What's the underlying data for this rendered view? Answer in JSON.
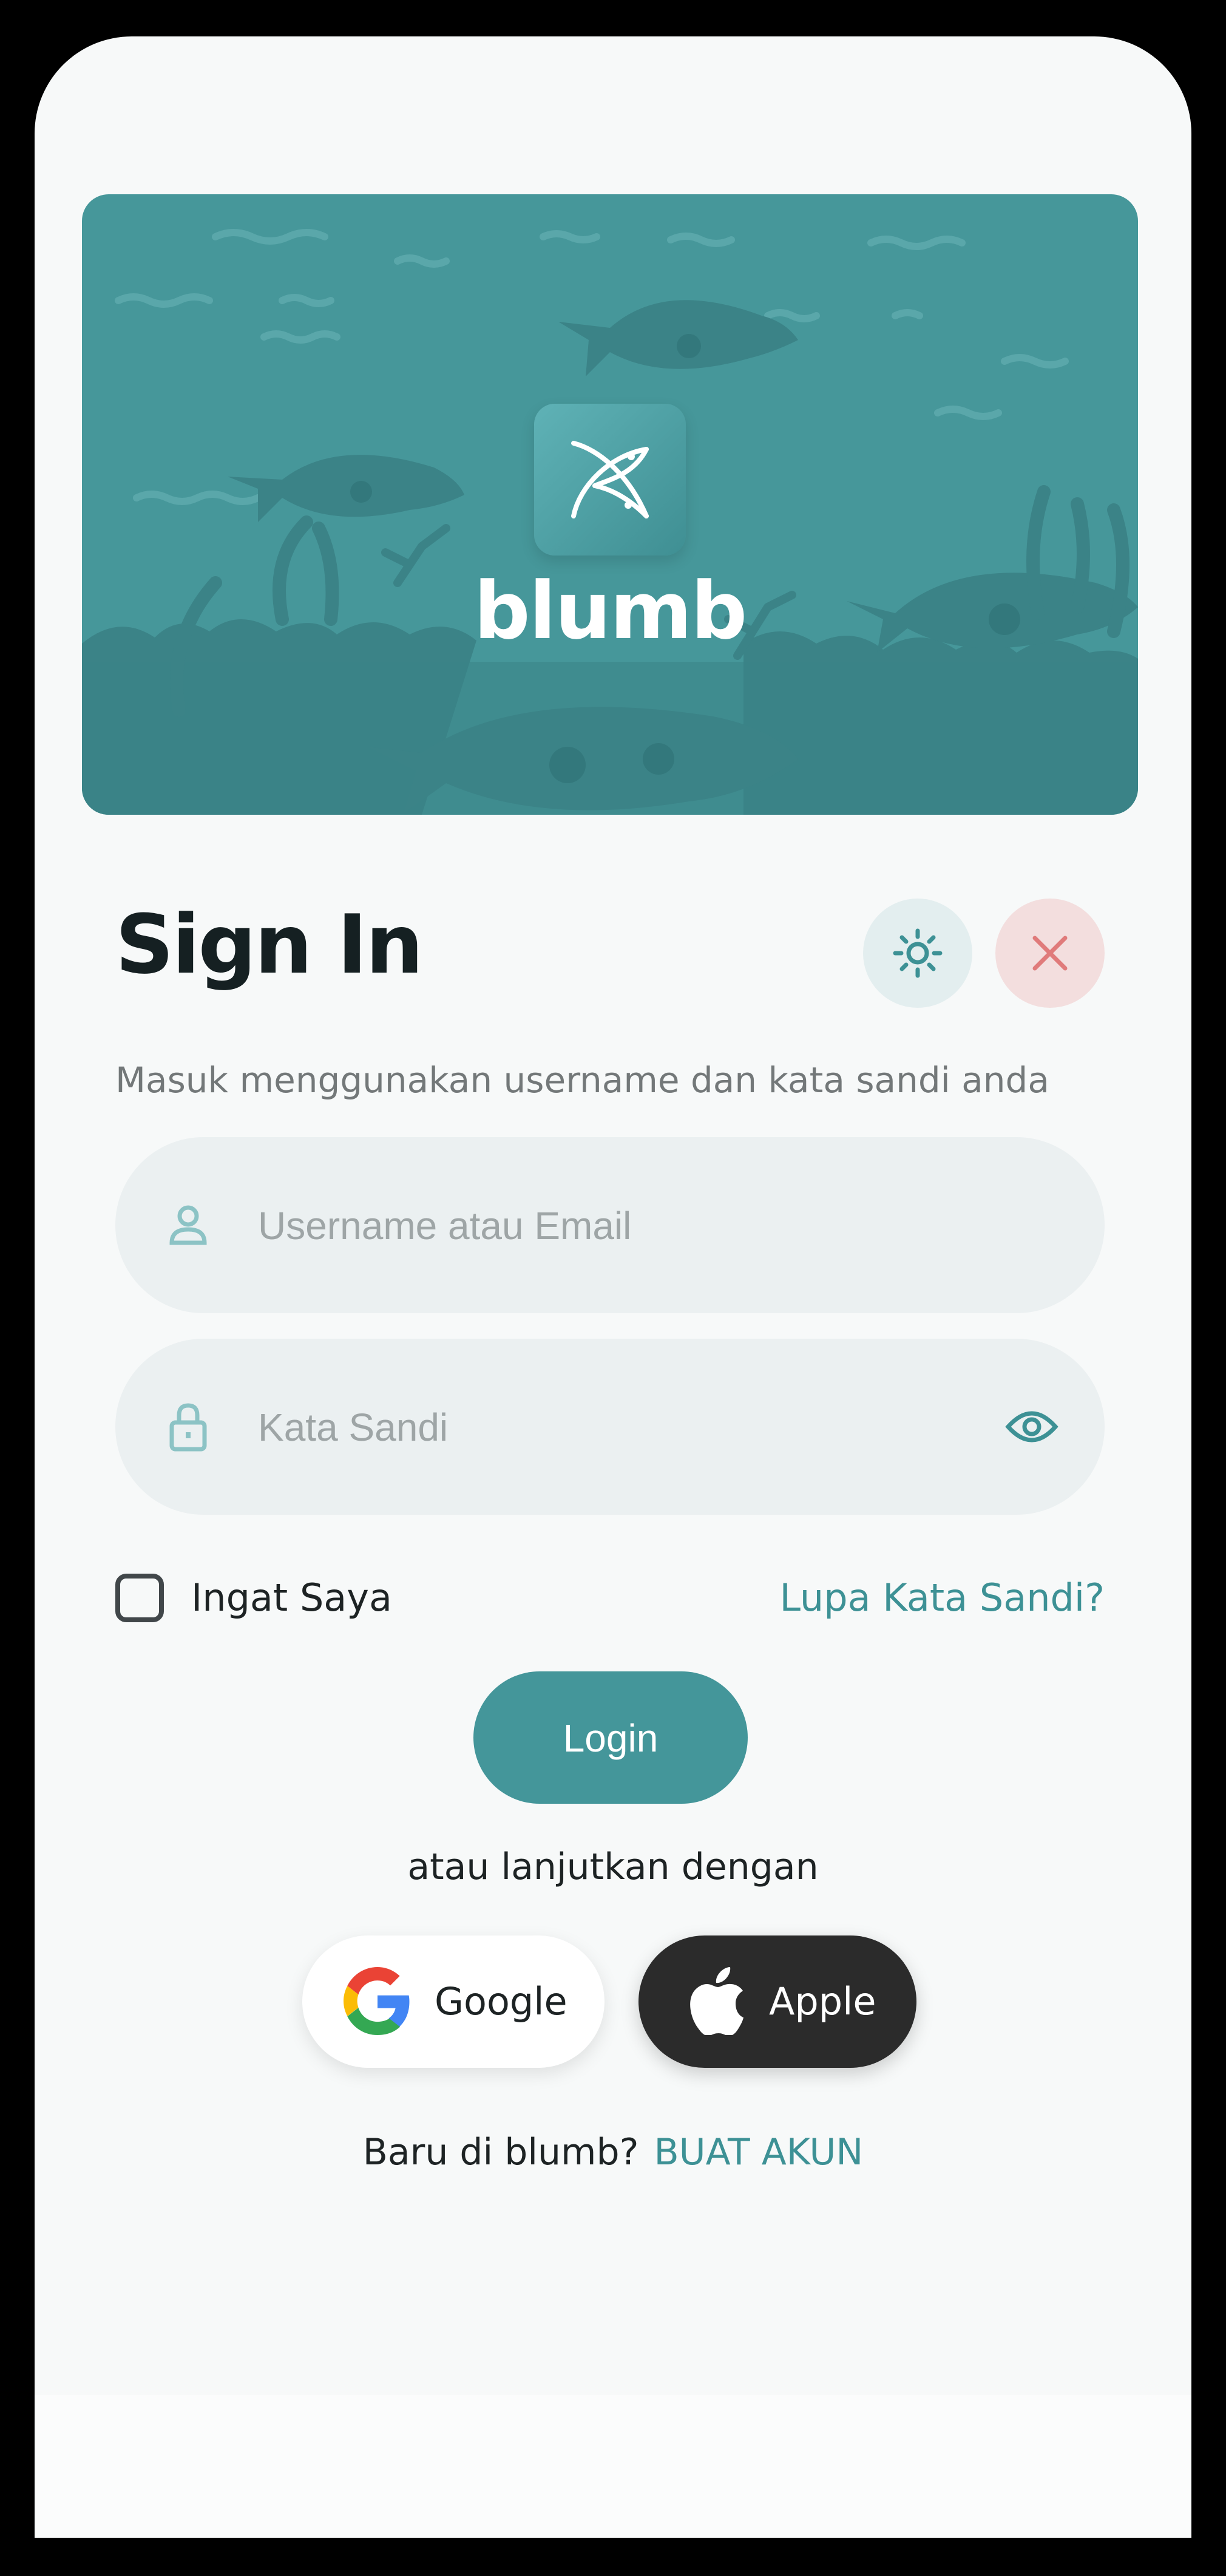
{
  "brand": {
    "name": "blumb"
  },
  "header": {
    "title": "Sign In",
    "subtitle": "Masuk menggunakan username dan kata sandi anda"
  },
  "form": {
    "username_placeholder": "Username atau Email",
    "password_placeholder": "Kata Sandi",
    "remember_label": "Ingat Saya",
    "remember_checked": false,
    "forgot_label": "Lupa Kata Sandi?",
    "login_label": "Login"
  },
  "social": {
    "divider_text": "atau lanjutkan dengan",
    "google_label": "Google",
    "apple_label": "Apple"
  },
  "signup": {
    "prompt": "Baru di blumb?",
    "link_label": "BUAT AKUN"
  },
  "icons": {
    "theme": "sun-icon",
    "close": "close-icon",
    "user": "user-icon",
    "lock": "lock-icon",
    "eye": "eye-icon",
    "google": "google-icon",
    "apple": "apple-icon",
    "logo": "fish-logo-icon"
  },
  "colors": {
    "accent": "#44969a",
    "banner": "#46979a",
    "close_tint": "#f3dede",
    "close_icon": "#e07b7b",
    "apple_button": "#2b2b2b",
    "background": "#f7f9f9"
  }
}
